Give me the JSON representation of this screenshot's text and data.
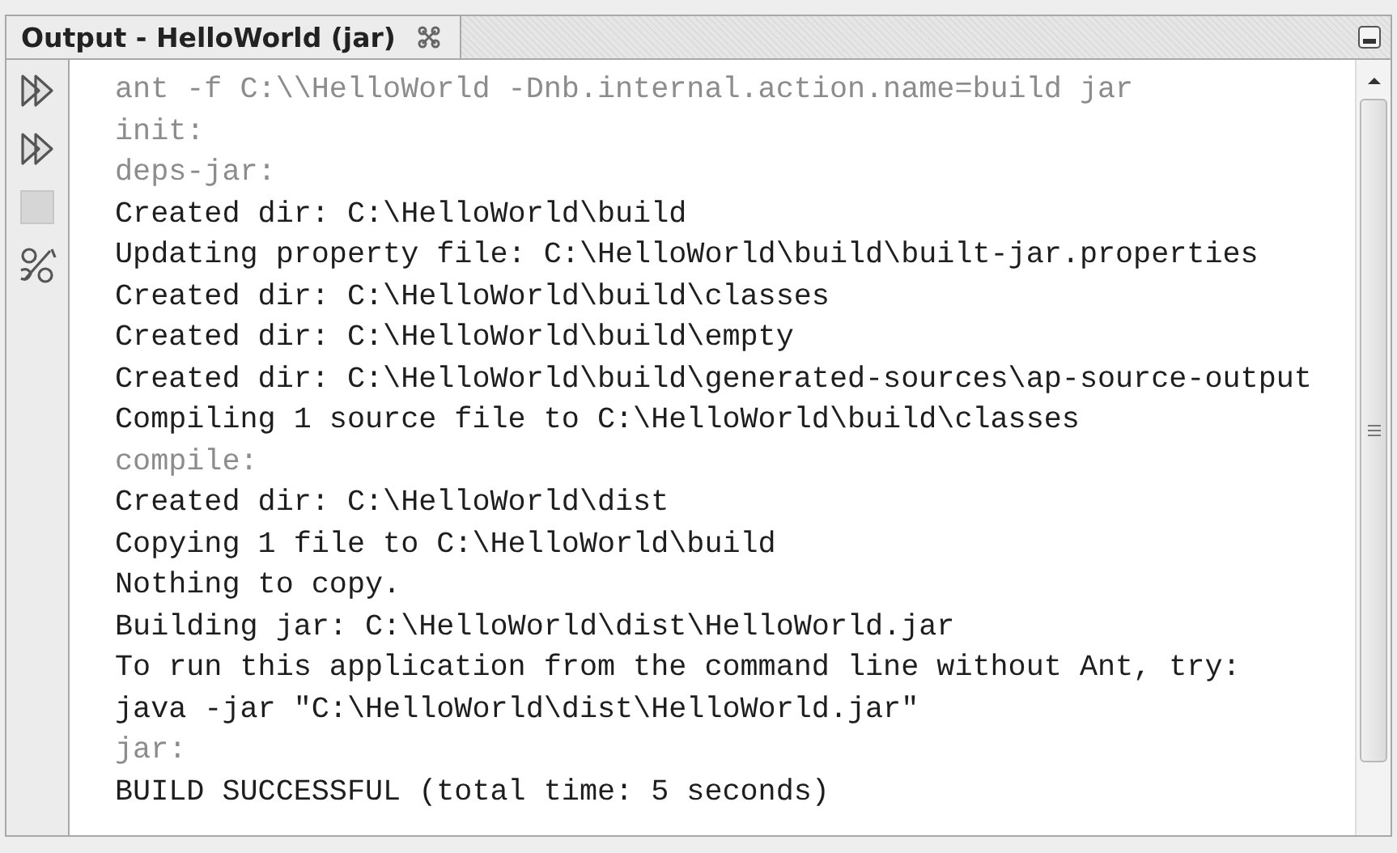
{
  "tab": {
    "title": "Output - HelloWorld (jar)",
    "selected": true
  },
  "toolbar": [
    {
      "kind": "rerun",
      "disabled": false
    },
    {
      "kind": "rerun",
      "disabled": false
    },
    {
      "kind": "stop",
      "disabled": true
    },
    {
      "kind": "settings",
      "disabled": false
    }
  ],
  "lines": [
    {
      "kind": "ant",
      "text": "ant -f C:\\\\HelloWorld -Dnb.internal.action.name=build jar"
    },
    {
      "kind": "ant",
      "text": "init:"
    },
    {
      "kind": "ant",
      "text": "deps-jar:"
    },
    {
      "kind": "log",
      "text": "Created dir: C:\\HelloWorld\\build"
    },
    {
      "kind": "log",
      "text": "Updating property file: C:\\HelloWorld\\build\\built-jar.properties"
    },
    {
      "kind": "log",
      "text": "Created dir: C:\\HelloWorld\\build\\classes"
    },
    {
      "kind": "log",
      "text": "Created dir: C:\\HelloWorld\\build\\empty"
    },
    {
      "kind": "log",
      "text": "Created dir: C:\\HelloWorld\\build\\generated-sources\\ap-source-output"
    },
    {
      "kind": "log",
      "text": "Compiling 1 source file to C:\\HelloWorld\\build\\classes"
    },
    {
      "kind": "ant",
      "text": "compile:"
    },
    {
      "kind": "log",
      "text": "Created dir: C:\\HelloWorld\\dist"
    },
    {
      "kind": "log",
      "text": "Copying 1 file to C:\\HelloWorld\\build"
    },
    {
      "kind": "log",
      "text": "Nothing to copy."
    },
    {
      "kind": "log",
      "text": "Building jar: C:\\HelloWorld\\dist\\HelloWorld.jar"
    },
    {
      "kind": "log",
      "text": "To run this application from the command line without Ant, try:"
    },
    {
      "kind": "log",
      "text": "java -jar \"C:\\HelloWorld\\dist\\HelloWorld.jar\""
    },
    {
      "kind": "ant",
      "text": "jar:"
    },
    {
      "kind": "log",
      "text": "BUILD SUCCESSFUL (total time: 5 seconds)"
    }
  ]
}
